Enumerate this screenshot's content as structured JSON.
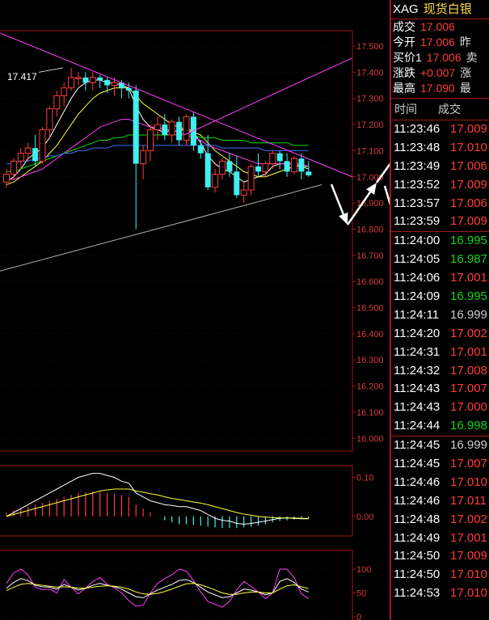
{
  "chart_data": {
    "type": "candlestick",
    "ylim": [
      16.0,
      17.55
    ],
    "price_ticks": [
      "17.500",
      "17.400",
      "17.300",
      "17.200",
      "17.100",
      "17.000",
      "16.900",
      "16.800",
      "16.700",
      "16.600",
      "16.500",
      "16.400",
      "16.300",
      "16.200",
      "16.100",
      "16.000"
    ],
    "annotation_high": "17.417",
    "candles": [
      {
        "o": 16.98,
        "h": 17.03,
        "l": 16.96,
        "c": 17.01
      },
      {
        "o": 17.01,
        "h": 17.07,
        "l": 16.99,
        "c": 17.06
      },
      {
        "o": 17.06,
        "h": 17.11,
        "l": 17.03,
        "c": 17.09
      },
      {
        "o": 17.09,
        "h": 17.13,
        "l": 17.06,
        "c": 17.11
      },
      {
        "o": 17.11,
        "h": 17.16,
        "l": 17.04,
        "c": 17.06
      },
      {
        "o": 17.06,
        "h": 17.19,
        "l": 17.05,
        "c": 17.18
      },
      {
        "o": 17.18,
        "h": 17.27,
        "l": 17.15,
        "c": 17.26
      },
      {
        "o": 17.26,
        "h": 17.33,
        "l": 17.23,
        "c": 17.31
      },
      {
        "o": 17.31,
        "h": 17.36,
        "l": 17.27,
        "c": 17.34
      },
      {
        "o": 17.34,
        "h": 17.417,
        "l": 17.33,
        "c": 17.38
      },
      {
        "o": 17.38,
        "h": 17.4,
        "l": 17.35,
        "c": 17.38
      },
      {
        "o": 17.38,
        "h": 17.4,
        "l": 17.33,
        "c": 17.36
      },
      {
        "o": 17.36,
        "h": 17.4,
        "l": 17.33,
        "c": 17.38
      },
      {
        "o": 17.38,
        "h": 17.39,
        "l": 17.34,
        "c": 17.37
      },
      {
        "o": 17.37,
        "h": 17.38,
        "l": 17.32,
        "c": 17.35
      },
      {
        "o": 17.35,
        "h": 17.38,
        "l": 17.31,
        "c": 17.36
      },
      {
        "o": 17.36,
        "h": 17.37,
        "l": 17.3,
        "c": 17.34
      },
      {
        "o": 17.34,
        "h": 17.36,
        "l": 17.3,
        "c": 17.33
      },
      {
        "o": 17.33,
        "h": 17.35,
        "l": 16.8,
        "c": 17.05
      },
      {
        "o": 17.05,
        "h": 17.12,
        "l": 16.99,
        "c": 17.1
      },
      {
        "o": 17.1,
        "h": 17.2,
        "l": 17.06,
        "c": 17.18
      },
      {
        "o": 17.18,
        "h": 17.23,
        "l": 17.14,
        "c": 17.2
      },
      {
        "o": 17.2,
        "h": 17.24,
        "l": 17.14,
        "c": 17.16
      },
      {
        "o": 17.16,
        "h": 17.22,
        "l": 17.13,
        "c": 17.21
      },
      {
        "o": 17.21,
        "h": 17.23,
        "l": 17.12,
        "c": 17.14
      },
      {
        "o": 17.14,
        "h": 17.24,
        "l": 17.12,
        "c": 17.23
      },
      {
        "o": 17.23,
        "h": 17.25,
        "l": 17.1,
        "c": 17.12
      },
      {
        "o": 17.12,
        "h": 17.14,
        "l": 17.07,
        "c": 17.09
      },
      {
        "o": 17.09,
        "h": 17.16,
        "l": 16.95,
        "c": 16.96
      },
      {
        "o": 16.96,
        "h": 17.03,
        "l": 16.94,
        "c": 17.01
      },
      {
        "o": 17.01,
        "h": 17.07,
        "l": 16.99,
        "c": 17.06
      },
      {
        "o": 17.06,
        "h": 17.09,
        "l": 17.0,
        "c": 17.02
      },
      {
        "o": 17.02,
        "h": 17.08,
        "l": 16.92,
        "c": 16.93
      },
      {
        "o": 16.93,
        "h": 16.98,
        "l": 16.9,
        "c": 16.95
      },
      {
        "o": 16.95,
        "h": 17.05,
        "l": 16.93,
        "c": 17.04
      },
      {
        "o": 17.04,
        "h": 17.09,
        "l": 17.0,
        "c": 17.02
      },
      {
        "o": 17.02,
        "h": 17.06,
        "l": 17.0,
        "c": 17.05
      },
      {
        "o": 17.05,
        "h": 17.1,
        "l": 17.03,
        "c": 17.09
      },
      {
        "o": 17.09,
        "h": 17.1,
        "l": 17.03,
        "c": 17.06
      },
      {
        "o": 17.06,
        "h": 17.09,
        "l": 17.0,
        "c": 17.02
      },
      {
        "o": 17.02,
        "h": 17.08,
        "l": 17.01,
        "c": 17.07
      },
      {
        "o": 17.07,
        "h": 17.09,
        "l": 16.99,
        "c": 17.02
      },
      {
        "o": 17.02,
        "h": 17.06,
        "l": 17.0,
        "c": 17.006
      }
    ],
    "ma_lines": [
      {
        "color": "#ffffff",
        "values": [
          16.98,
          17.0,
          17.03,
          17.07,
          17.09,
          17.11,
          17.15,
          17.2,
          17.25,
          17.3,
          17.34,
          17.36,
          17.37,
          17.37,
          17.36,
          17.36,
          17.35,
          17.34,
          17.27,
          17.22,
          17.19,
          17.18,
          17.17,
          17.18,
          17.17,
          17.19,
          17.17,
          17.13,
          17.08,
          17.05,
          17.03,
          17.02,
          17.0,
          16.98,
          16.99,
          17.0,
          17.01,
          17.04,
          17.05,
          17.05,
          17.05,
          17.04,
          17.03
        ]
      },
      {
        "color": "#ffff40",
        "values": [
          16.97,
          16.98,
          17.0,
          17.02,
          17.04,
          17.06,
          17.09,
          17.12,
          17.16,
          17.2,
          17.24,
          17.27,
          17.3,
          17.32,
          17.33,
          17.34,
          17.34,
          17.34,
          17.31,
          17.28,
          17.26,
          17.24,
          17.22,
          17.2,
          17.19,
          17.18,
          17.17,
          17.16,
          17.13,
          17.1,
          17.08,
          17.06,
          17.04,
          17.02,
          17.01,
          17.0,
          17.0,
          17.01,
          17.02,
          17.03,
          17.04,
          17.04,
          17.04
        ]
      },
      {
        "color": "#ff40ff",
        "values": [
          16.99,
          16.99,
          17.0,
          17.01,
          17.02,
          17.03,
          17.05,
          17.07,
          17.09,
          17.11,
          17.13,
          17.15,
          17.17,
          17.19,
          17.2,
          17.21,
          17.22,
          17.22,
          17.21,
          17.2,
          17.19,
          17.19,
          17.18,
          17.18,
          17.17,
          17.16,
          17.15,
          17.14,
          17.12,
          17.11,
          17.1,
          17.09,
          17.08,
          17.07,
          17.06,
          17.05,
          17.05,
          17.05,
          17.05,
          17.05,
          17.05,
          17.05,
          17.04
        ]
      },
      {
        "color": "#00e000",
        "values": [
          17.02,
          17.02,
          17.03,
          17.04,
          17.05,
          17.06,
          17.07,
          17.08,
          17.09,
          17.1,
          17.11,
          17.12,
          17.13,
          17.14,
          17.14,
          17.15,
          17.15,
          17.16,
          17.16,
          17.16,
          17.16,
          17.16,
          17.16,
          17.16,
          17.16,
          17.16,
          17.16,
          17.15,
          17.15,
          17.15,
          17.14,
          17.14,
          17.14,
          17.14,
          17.13,
          17.13,
          17.13,
          17.13,
          17.13,
          17.13,
          17.12,
          17.12,
          17.12
        ]
      },
      {
        "color": "#4070ff",
        "values": [
          17.05,
          17.05,
          17.06,
          17.06,
          17.07,
          17.07,
          17.08,
          17.08,
          17.09,
          17.09,
          17.1,
          17.1,
          17.11,
          17.11,
          17.11,
          17.12,
          17.12,
          17.12,
          17.12,
          17.12,
          17.12,
          17.12,
          17.12,
          17.12,
          17.12,
          17.12,
          17.12,
          17.12,
          17.12,
          17.12,
          17.11,
          17.11,
          17.11,
          17.11,
          17.11,
          17.11,
          17.1,
          17.1,
          17.1,
          17.1,
          17.1,
          17.1,
          17.1
        ]
      }
    ],
    "ma_long_gray": [
      16.64,
      16.97
    ],
    "macd_ticks": [
      "0.10",
      "0.00"
    ],
    "macd_range": [
      -0.05,
      0.13
    ],
    "macd_hist": [
      0.01,
      0.015,
      0.02,
      0.025,
      0.03,
      0.035,
      0.04,
      0.045,
      0.05,
      0.055,
      0.06,
      0.062,
      0.064,
      0.063,
      0.06,
      0.058,
      0.055,
      0.05,
      0.03,
      0.02,
      0.01,
      0.0,
      -0.01,
      -0.015,
      -0.02,
      -0.02,
      -0.022,
      -0.024,
      -0.026,
      -0.028,
      -0.03,
      -0.03,
      -0.03,
      -0.028,
      -0.026,
      -0.024,
      -0.02,
      -0.015,
      -0.012,
      -0.01,
      -0.008,
      -0.006,
      -0.005
    ],
    "macd_dif": [
      0.0,
      0.01,
      0.02,
      0.03,
      0.04,
      0.05,
      0.06,
      0.07,
      0.08,
      0.09,
      0.1,
      0.105,
      0.11,
      0.11,
      0.105,
      0.1,
      0.09,
      0.085,
      0.06,
      0.05,
      0.04,
      0.035,
      0.03,
      0.028,
      0.025,
      0.025,
      0.02,
      0.015,
      0.005,
      -0.005,
      -0.01,
      -0.012,
      -0.018,
      -0.02,
      -0.018,
      -0.015,
      -0.012,
      -0.008,
      -0.005,
      -0.004,
      -0.005,
      -0.006,
      -0.006
    ],
    "macd_dea": [
      0.0,
      0.005,
      0.01,
      0.015,
      0.02,
      0.025,
      0.03,
      0.035,
      0.04,
      0.045,
      0.05,
      0.055,
      0.06,
      0.065,
      0.068,
      0.07,
      0.07,
      0.07,
      0.065,
      0.062,
      0.058,
      0.055,
      0.05,
      0.046,
      0.043,
      0.04,
      0.037,
      0.034,
      0.03,
      0.025,
      0.02,
      0.015,
      0.01,
      0.006,
      0.003,
      0.0,
      -0.002,
      -0.003,
      -0.004,
      -0.004,
      -0.004,
      -0.005,
      -0.005
    ],
    "kdj_ticks": [
      "100",
      "50",
      "0"
    ],
    "kdj_k": [
      60,
      72,
      80,
      76,
      66,
      63,
      62,
      58,
      68,
      62,
      56,
      60,
      66,
      70,
      66,
      63,
      58,
      50,
      42,
      40,
      48,
      56,
      62,
      68,
      76,
      78,
      72,
      62,
      52,
      46,
      40,
      42,
      50,
      58,
      56,
      52,
      46,
      50,
      74,
      80,
      72,
      58,
      52
    ],
    "kdj_d": [
      55,
      62,
      68,
      70,
      68,
      66,
      64,
      62,
      63,
      62,
      60,
      60,
      62,
      64,
      65,
      64,
      62,
      58,
      52,
      48,
      47,
      49,
      53,
      58,
      64,
      69,
      70,
      67,
      62,
      56,
      50,
      47,
      47,
      50,
      52,
      52,
      50,
      50,
      58,
      65,
      67,
      63,
      59
    ],
    "kdj_j": [
      70,
      92,
      104,
      88,
      62,
      57,
      58,
      50,
      78,
      62,
      48,
      60,
      74,
      82,
      68,
      61,
      50,
      34,
      22,
      24,
      50,
      70,
      80,
      88,
      100,
      96,
      76,
      52,
      32,
      26,
      20,
      32,
      56,
      74,
      64,
      52,
      38,
      50,
      106,
      110,
      82,
      48,
      38
    ]
  },
  "panel": {
    "symbol": "XAG",
    "name": "现货白银",
    "quotes": [
      {
        "label": "成交",
        "value": "17.006",
        "extra": ""
      },
      {
        "label": "今开",
        "value": "17.006",
        "extra": "昨"
      },
      {
        "label": "买价1",
        "value": "17.006",
        "extra": "卖"
      },
      {
        "label": "涨跌",
        "value": "+0.007",
        "extra": "涨"
      },
      {
        "label": "最高",
        "value": "17.090",
        "extra": "最"
      }
    ],
    "col_time": "时间",
    "col_price": "成交",
    "trades": [
      {
        "t": "11:23:46",
        "p": "17.009",
        "c": "#ff3b3b"
      },
      {
        "t": "11:23:48",
        "p": "17.010",
        "c": "#ff3b3b"
      },
      {
        "t": "11:23:49",
        "p": "17.006",
        "c": "#ff3b3b"
      },
      {
        "t": "11:23:52",
        "p": "17.009",
        "c": "#ff3b3b"
      },
      {
        "t": "11:23:57",
        "p": "17.006",
        "c": "#ff3b3b"
      },
      {
        "t": "11:23:59",
        "p": "17.009",
        "c": "#ff3b3b"
      },
      {
        "t": "11:24:00",
        "p": "16.995",
        "c": "#19d219"
      },
      {
        "t": "11:24:05",
        "p": "16.987",
        "c": "#19d219"
      },
      {
        "t": "11:24:06",
        "p": "17.001",
        "c": "#ff3b3b"
      },
      {
        "t": "11:24:09",
        "p": "16.995",
        "c": "#19d219"
      },
      {
        "t": "11:24:11",
        "p": "16.999",
        "c": "#cccccc"
      },
      {
        "t": "11:24:20",
        "p": "17.002",
        "c": "#ff3b3b"
      },
      {
        "t": "11:24:31",
        "p": "17.001",
        "c": "#ff3b3b"
      },
      {
        "t": "11:24:32",
        "p": "17.008",
        "c": "#ff3b3b"
      },
      {
        "t": "11:24:43",
        "p": "17.007",
        "c": "#ff3b3b"
      },
      {
        "t": "11:24:43",
        "p": "17.000",
        "c": "#ff3b3b"
      },
      {
        "t": "11:24:44",
        "p": "16.998",
        "c": "#19d219"
      },
      {
        "t": "11:24:45",
        "p": "16.999",
        "c": "#cccccc"
      },
      {
        "t": "11:24:45",
        "p": "17.007",
        "c": "#ff3b3b"
      },
      {
        "t": "11:24:46",
        "p": "17.010",
        "c": "#ff3b3b"
      },
      {
        "t": "11:24:46",
        "p": "17.011",
        "c": "#ff3b3b"
      },
      {
        "t": "11:24:48",
        "p": "17.002",
        "c": "#ff3b3b"
      },
      {
        "t": "11:24:49",
        "p": "17.001",
        "c": "#ff3b3b"
      },
      {
        "t": "11:24:50",
        "p": "17.009",
        "c": "#ff3b3b"
      },
      {
        "t": "11:24:50",
        "p": "17.010",
        "c": "#ff3b3b"
      },
      {
        "t": "11:24:53",
        "p": "17.010",
        "c": "#ff3b3b"
      }
    ]
  },
  "colors": {
    "up_red": "#ff3b3b",
    "down_cyan": "#40f0f0",
    "grid_red": "#a01818",
    "trend_magenta": "#ff40ff"
  }
}
